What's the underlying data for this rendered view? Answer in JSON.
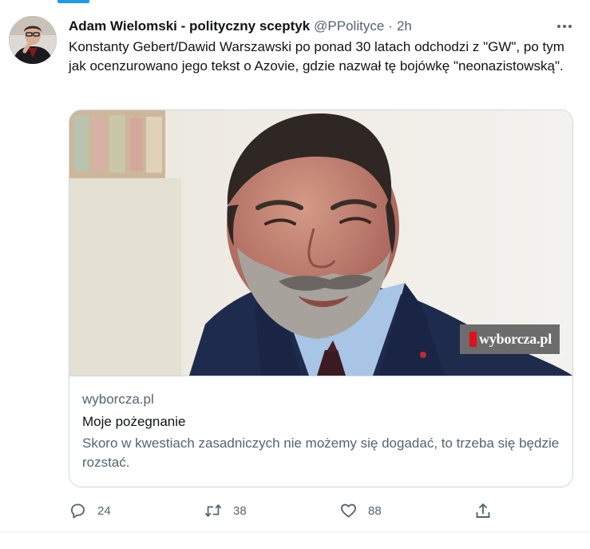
{
  "tweet": {
    "display_name": "Adam Wielomski - polityczny sceptyk",
    "handle": "@PPolityce",
    "separator": "·",
    "time": "2h",
    "text": "Konstanty Gebert/Dawid Warszawski po ponad 30 latach odchodzi z \"GW\", po tym jak ocenzurowano jego tekst o Azovie, gdzie nazwał tę bojówkę \"neonazistowską\"."
  },
  "card": {
    "domain": "wyborcza.pl",
    "title": "Moje pożegnanie",
    "description": "Skoro w kwestiach zasadniczych nie możemy się dogadać, to trzeba się będzie rozstać.",
    "watermark": "wyborcza.pl",
    "watermark_color": "#e2101a"
  },
  "actions": {
    "reply_count": "24",
    "retweet_count": "38",
    "like_count": "88"
  },
  "icons": {
    "more": "more-icon",
    "reply": "reply-icon",
    "retweet": "retweet-icon",
    "like": "heart-icon",
    "share": "share-icon"
  },
  "colors": {
    "accent": "#1d9bf0",
    "text": "#0f1419",
    "secondary": "#536471",
    "border": "#cfd9de"
  }
}
